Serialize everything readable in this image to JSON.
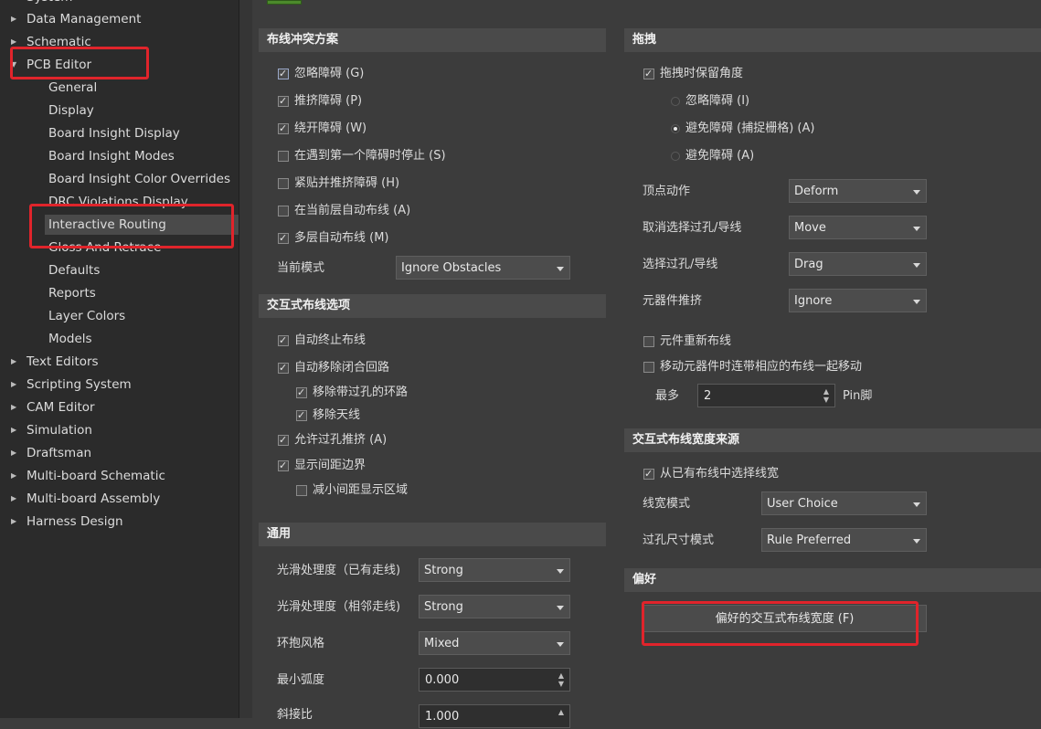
{
  "sidebar": {
    "items": [
      {
        "label": "System"
      },
      {
        "label": "Data Management"
      },
      {
        "label": "Schematic"
      },
      {
        "label": "PCB Editor"
      },
      {
        "label": "General"
      },
      {
        "label": "Display"
      },
      {
        "label": "Board Insight Display"
      },
      {
        "label": "Board Insight Modes"
      },
      {
        "label": "Board Insight Color Overrides"
      },
      {
        "label": "DRC Violations Display"
      },
      {
        "label": "Interactive Routing"
      },
      {
        "label": "Gloss And Retrace"
      },
      {
        "label": "Defaults"
      },
      {
        "label": "Reports"
      },
      {
        "label": "Layer Colors"
      },
      {
        "label": "Models"
      },
      {
        "label": "Text Editors"
      },
      {
        "label": "Scripting System"
      },
      {
        "label": "CAM Editor"
      },
      {
        "label": "Simulation"
      },
      {
        "label": "Draftsman"
      },
      {
        "label": "Multi-board Schematic"
      },
      {
        "label": "Multi-board Assembly"
      },
      {
        "label": "Harness Design"
      }
    ]
  },
  "routing_conflict": {
    "title": "布线冲突方案",
    "options": [
      {
        "text": "忽略障碍 (G)",
        "checked": true
      },
      {
        "text": "推挤障碍 (P)",
        "checked": true
      },
      {
        "text": "绕开障碍 (W)",
        "checked": true
      },
      {
        "text": "在遇到第一个障碍时停止 (S)",
        "checked": false
      },
      {
        "text": "紧贴并推挤障碍 (H)",
        "checked": false
      },
      {
        "text": "在当前层自动布线 (A)",
        "checked": false
      },
      {
        "text": "多层自动布线 (M)",
        "checked": true
      }
    ],
    "mode_label": "当前模式",
    "mode_value": "Ignore Obstacles"
  },
  "interactive_options": {
    "title": "交互式布线选项",
    "options": [
      {
        "text": "自动终止布线",
        "checked": true
      },
      {
        "text": "自动移除闭合回路",
        "checked": true
      },
      {
        "text": "移除带过孔的环路",
        "checked": true
      },
      {
        "text": "移除天线",
        "checked": true
      },
      {
        "text": "允许过孔推挤 (A)",
        "checked": true
      },
      {
        "text": "显示间距边界",
        "checked": true
      },
      {
        "text": "减小间距显示区域",
        "checked": false
      }
    ]
  },
  "general": {
    "title": "通用",
    "fields": [
      {
        "label": "光滑处理度（已有走线)",
        "value": "Strong"
      },
      {
        "label": "光滑处理度（相邻走线)",
        "value": "Strong"
      },
      {
        "label": "环抱风格",
        "value": "Mixed"
      },
      {
        "label": "最小弧度",
        "value": "0.000"
      },
      {
        "label": "斜接比",
        "value": "1.000"
      }
    ]
  },
  "drag": {
    "title": "拖拽",
    "keep_angle": "拖拽时保留角度",
    "keep_angle_checked": true,
    "radios": [
      {
        "text": "忽略障碍 (I)",
        "on": false
      },
      {
        "text": "避免障碍 (捕捉栅格) (A)",
        "on": true
      },
      {
        "text": "避免障碍 (A)",
        "on": false
      }
    ],
    "fields": [
      {
        "label": "顶点动作",
        "value": "Deform"
      },
      {
        "label": "取消选择过孔/导线",
        "value": "Move"
      },
      {
        "label": "选择过孔/导线",
        "value": "Drag"
      },
      {
        "label": "元器件推挤",
        "value": "Ignore"
      }
    ],
    "reroute": "元件重新布线",
    "reroute_checked": false,
    "move_with": "移动元器件时连带相应的布线一起移动",
    "move_with_checked": false,
    "max_label": "最多",
    "max_value": "2",
    "max_unit": "Pin脚"
  },
  "width_source": {
    "title": "交互式布线宽度来源",
    "pick": "从已有布线中选择线宽",
    "pick_checked": true,
    "fields": [
      {
        "label": "线宽模式",
        "value": "User Choice"
      },
      {
        "label": "过孔尺寸模式",
        "value": "Rule Preferred"
      }
    ]
  },
  "preferences": {
    "title": "偏好",
    "button": "偏好的交互式布线宽度 (F)"
  },
  "colors": {
    "highlight": "#e0242b",
    "background": "#3c3c3c",
    "header": "#4a4a4a"
  }
}
